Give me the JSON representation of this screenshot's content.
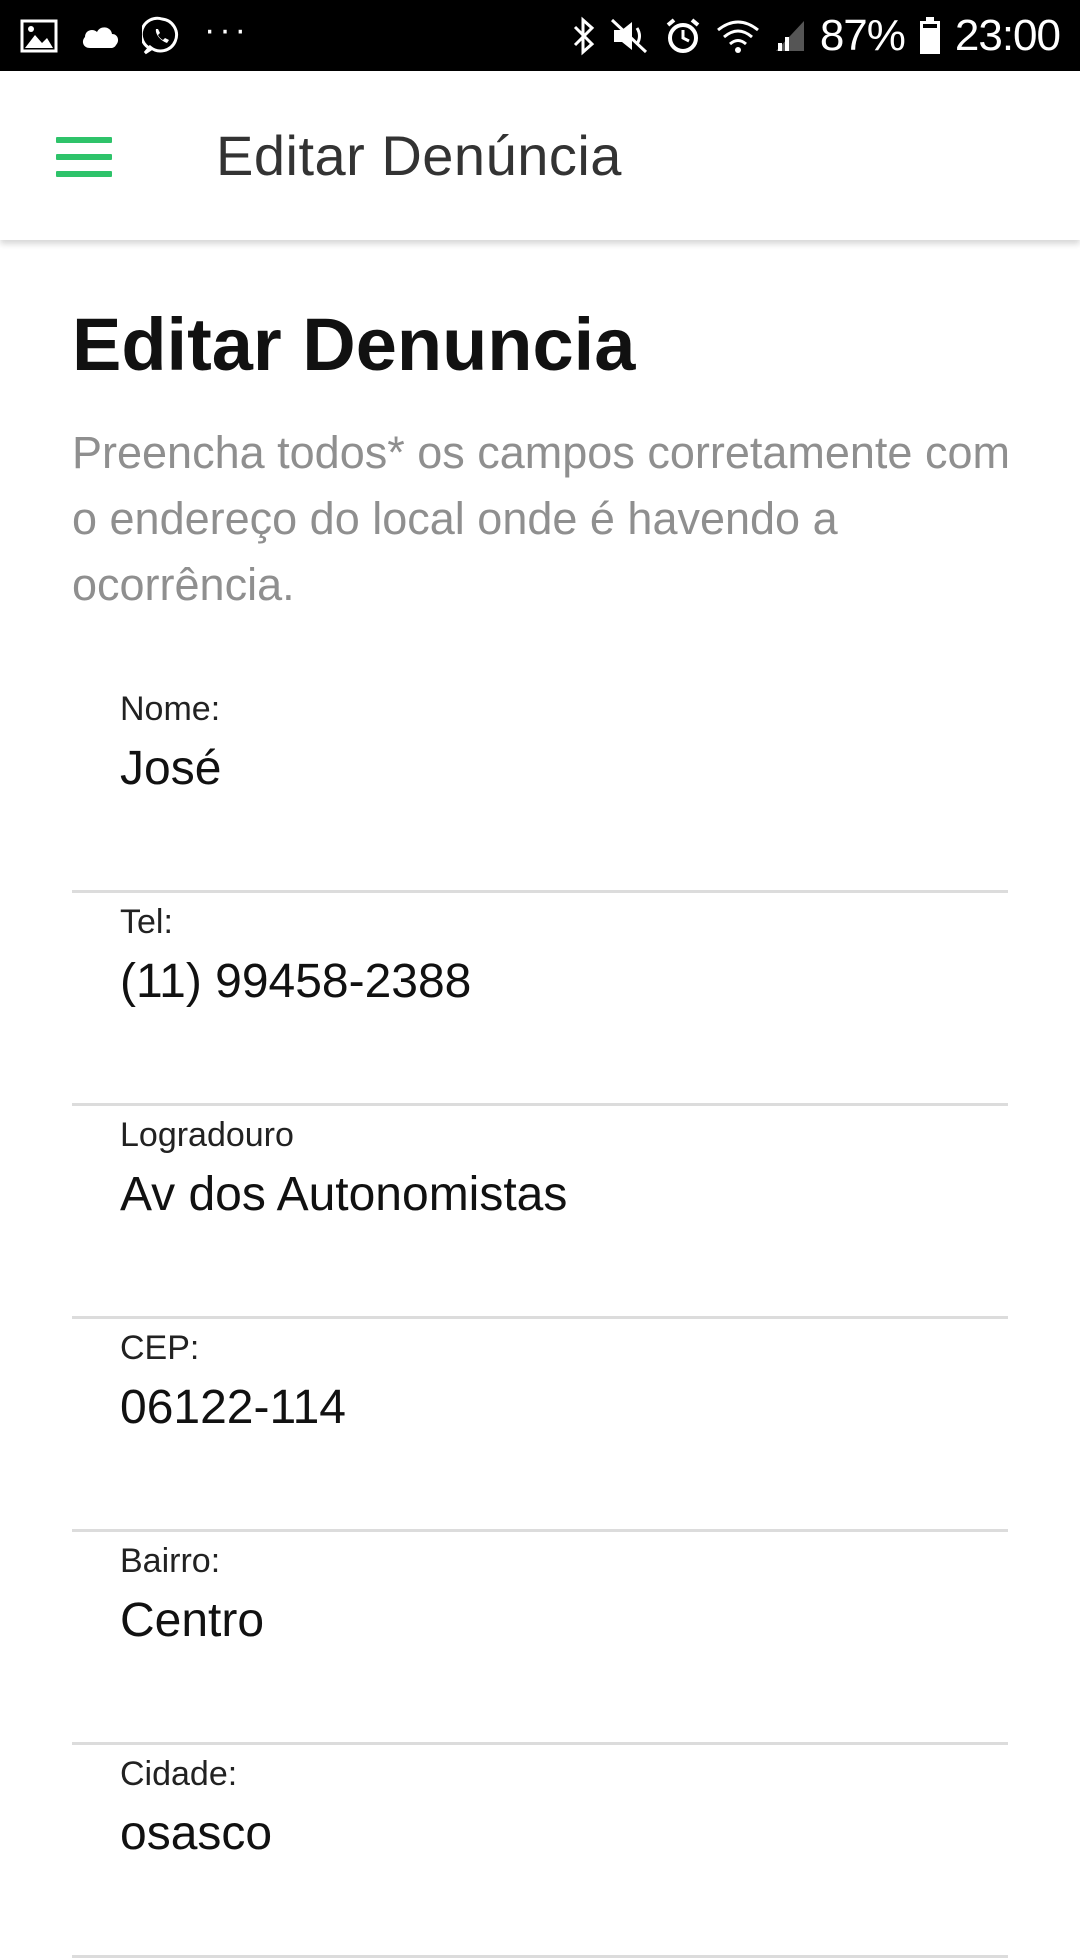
{
  "status_bar": {
    "left_icons": [
      "image-icon",
      "cloud-icon",
      "whatsapp-icon"
    ],
    "more_dots": "···",
    "right_icons": [
      "bluetooth-icon",
      "mute-icon",
      "alarm-icon",
      "wifi-icon",
      "signal-icon",
      "battery-icon"
    ],
    "battery": "87%",
    "time": "23:00"
  },
  "app_bar": {
    "menu_icon": "hamburger-menu-icon",
    "accent_color": "#2ec36a",
    "title": "Editar Denúncia"
  },
  "page": {
    "heading": "Editar Denuncia",
    "description": "Preencha todos* os campos corretamente com o endereço do local onde é havendo a ocorrência."
  },
  "form": {
    "fields": [
      {
        "label": "Nome:",
        "value": "José"
      },
      {
        "label": "Tel:",
        "value": "(11) 99458-2388"
      },
      {
        "label": "Logradouro",
        "value": "Av dos Autonomistas"
      },
      {
        "label": "CEP:",
        "value": "06122-114"
      },
      {
        "label": "Bairro:",
        "value": "Centro"
      },
      {
        "label": "Cidade:",
        "value": "osasco"
      }
    ]
  }
}
